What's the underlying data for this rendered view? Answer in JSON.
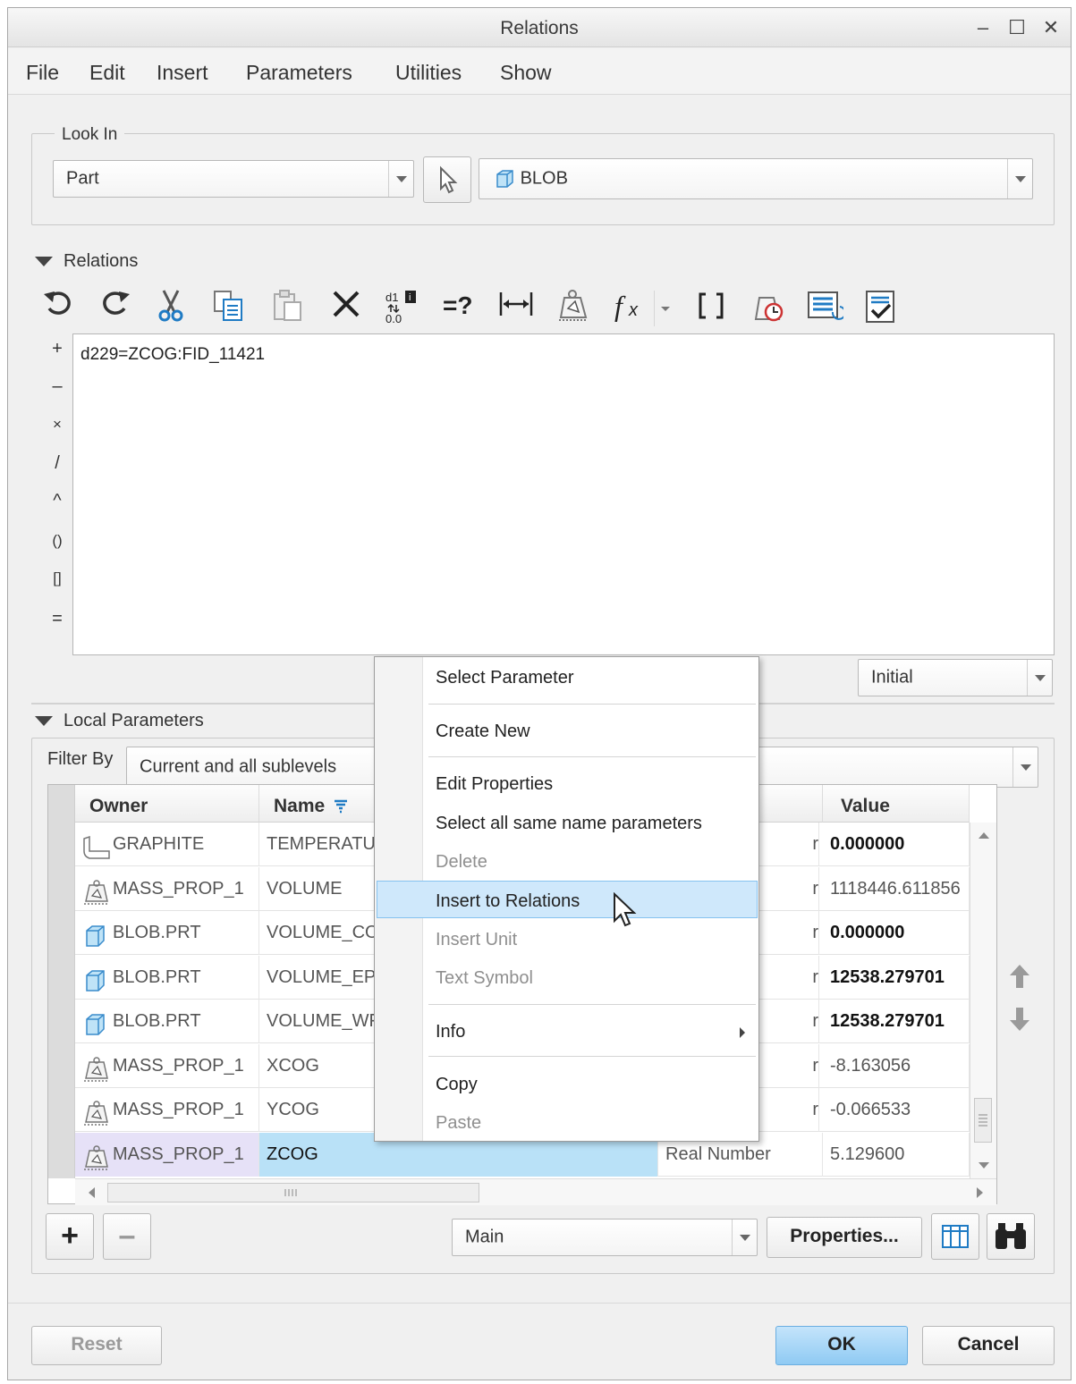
{
  "window": {
    "title": "Relations",
    "minimize": "–",
    "maximize": "☐",
    "close": "✕"
  },
  "menu": [
    "File",
    "Edit",
    "Insert",
    "Parameters",
    "Utilities",
    "Show"
  ],
  "lookin": {
    "label": "Look In",
    "type_value": "Part",
    "object_value": "BLOB"
  },
  "relations": {
    "label": "Relations",
    "toolbar": [
      "undo-icon",
      "redo-icon",
      "cut-icon",
      "copy-icon",
      "paste-icon",
      "delete-icon",
      "evaluate-icon",
      "check-icon",
      "dimension-icon",
      "mass-props-icon",
      "function-icon",
      "brackets-icon",
      "verify-icon",
      "sort-icon",
      "verify-relations-icon"
    ],
    "operators": [
      "+",
      "–",
      "×",
      "/",
      "^",
      "()",
      "[]",
      "="
    ],
    "text": "d229=ZCOG:FID_11421",
    "mode_value": "Initial"
  },
  "local_params": {
    "label": "Local Parameters",
    "filter_label": "Filter By",
    "filter_value": "Current and all sublevels",
    "columns": {
      "owner": "Owner",
      "name": "Name",
      "value": "Value"
    },
    "rows": [
      {
        "owner": "GRAPHITE",
        "name": "TEMPERATUR",
        "type": "r",
        "value": "0.000000"
      },
      {
        "owner": "MASS_PROP_1",
        "name": "VOLUME",
        "type": "r",
        "value": "1118446.611856"
      },
      {
        "owner": "BLOB.PRT",
        "name": "VOLUME_CO",
        "type": "r",
        "value": "0.000000"
      },
      {
        "owner": "BLOB.PRT",
        "name": "VOLUME_EP",
        "type": "r",
        "value": "12538.279701"
      },
      {
        "owner": "BLOB.PRT",
        "name": "VOLUME_WF",
        "type": "r",
        "value": "12538.279701"
      },
      {
        "owner": "MASS_PROP_1",
        "name": "XCOG",
        "type": "r",
        "value": "-8.163056"
      },
      {
        "owner": "MASS_PROP_1",
        "name": "YCOG",
        "type": "r",
        "value": "-0.066533"
      },
      {
        "owner": "MASS_PROP_1",
        "name": "ZCOG",
        "type": "Real Number",
        "value": "5.129600"
      }
    ],
    "view_value": "Main",
    "properties_label": "Properties..."
  },
  "context_menu": {
    "select_parameter": "Select Parameter",
    "create_new": "Create New",
    "edit_properties": "Edit Properties",
    "select_all_same": "Select all same name parameters",
    "delete": "Delete",
    "insert_to_relations": "Insert to Relations",
    "insert_unit": "Insert Unit",
    "text_symbol": "Text Symbol",
    "info": "Info",
    "copy": "Copy",
    "paste": "Paste"
  },
  "buttons": {
    "reset": "Reset",
    "ok": "OK",
    "cancel": "Cancel",
    "add": "+",
    "remove": "–"
  },
  "colors": {
    "selection": "#b9e1f7",
    "ok_button": "#9fd2f7",
    "menu_highlight": "#cfe8fb"
  }
}
